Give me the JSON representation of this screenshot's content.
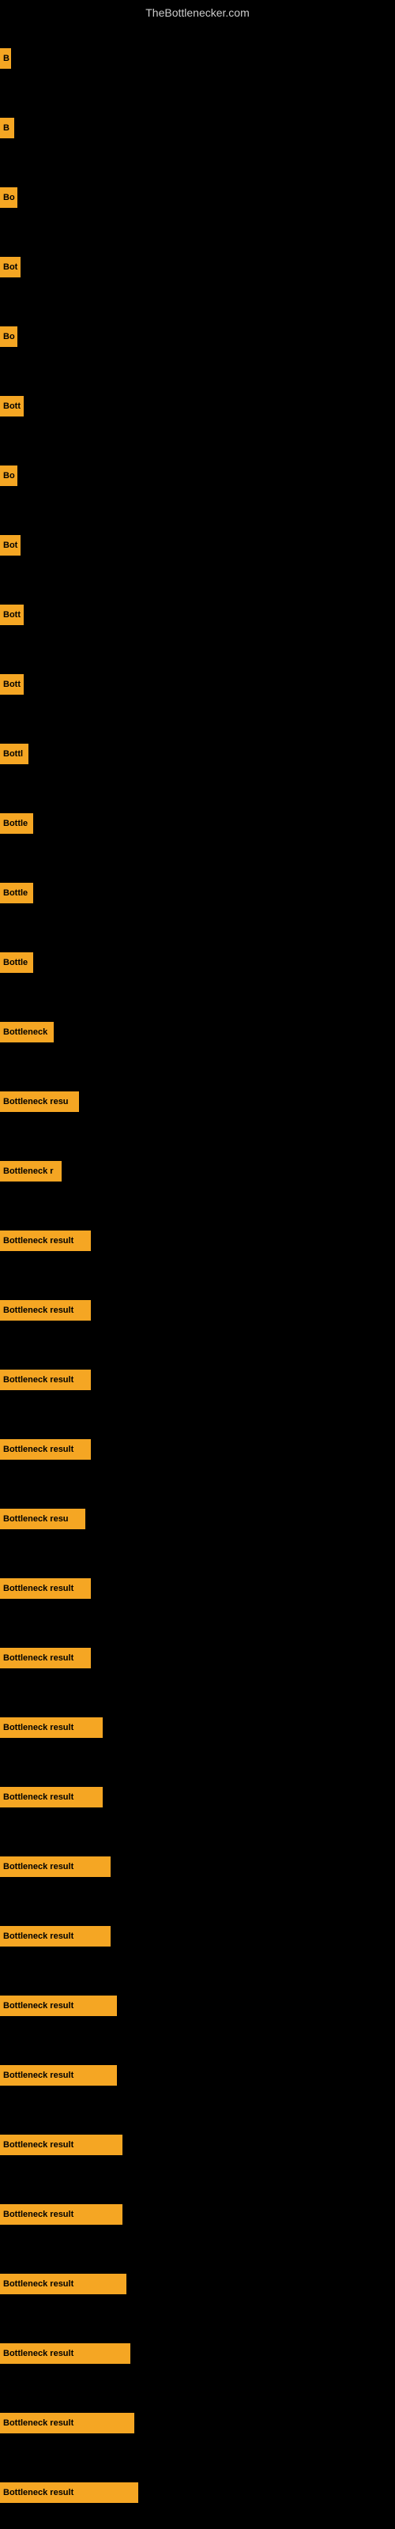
{
  "site": {
    "title": "TheBottlenecker.com"
  },
  "bars": [
    {
      "label": "B",
      "width": 14
    },
    {
      "label": "B",
      "width": 18
    },
    {
      "label": "Bo",
      "width": 22
    },
    {
      "label": "Bot",
      "width": 26
    },
    {
      "label": "Bo",
      "width": 22
    },
    {
      "label": "Bott",
      "width": 30
    },
    {
      "label": "Bo",
      "width": 22
    },
    {
      "label": "Bot",
      "width": 26
    },
    {
      "label": "Bott",
      "width": 30
    },
    {
      "label": "Bott",
      "width": 30
    },
    {
      "label": "Bottl",
      "width": 36
    },
    {
      "label": "Bottle",
      "width": 42
    },
    {
      "label": "Bottle",
      "width": 42
    },
    {
      "label": "Bottle",
      "width": 42
    },
    {
      "label": "Bottleneck",
      "width": 68
    },
    {
      "label": "Bottleneck resu",
      "width": 100
    },
    {
      "label": "Bottleneck r",
      "width": 78
    },
    {
      "label": "Bottleneck result",
      "width": 115
    },
    {
      "label": "Bottleneck result",
      "width": 115
    },
    {
      "label": "Bottleneck result",
      "width": 115
    },
    {
      "label": "Bottleneck result",
      "width": 115
    },
    {
      "label": "Bottleneck resu",
      "width": 108
    },
    {
      "label": "Bottleneck result",
      "width": 115
    },
    {
      "label": "Bottleneck result",
      "width": 115
    },
    {
      "label": "Bottleneck result",
      "width": 130
    },
    {
      "label": "Bottleneck result",
      "width": 130
    },
    {
      "label": "Bottleneck result",
      "width": 140
    },
    {
      "label": "Bottleneck result",
      "width": 140
    },
    {
      "label": "Bottleneck result",
      "width": 148
    },
    {
      "label": "Bottleneck result",
      "width": 148
    },
    {
      "label": "Bottleneck result",
      "width": 155
    },
    {
      "label": "Bottleneck result",
      "width": 155
    },
    {
      "label": "Bottleneck result",
      "width": 160
    },
    {
      "label": "Bottleneck result",
      "width": 165
    },
    {
      "label": "Bottleneck result",
      "width": 170
    },
    {
      "label": "Bottleneck result",
      "width": 175
    }
  ]
}
